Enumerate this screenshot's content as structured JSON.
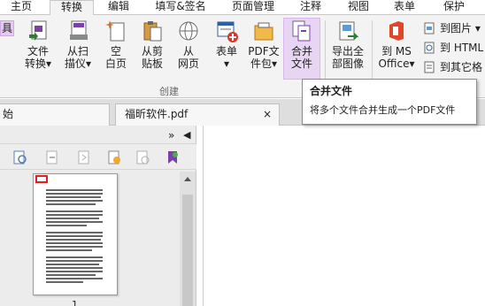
{
  "ribbon_tabs": [
    "主页",
    "转换",
    "编辑",
    "填写&签名",
    "页面管理",
    "注释",
    "视图",
    "表单",
    "保护"
  ],
  "active_tab": "转换",
  "left_stub": "具",
  "ribbon_buttons": {
    "file_convert": {
      "line1": "文件",
      "line2": "转换▾",
      "icon": "file-convert-icon"
    },
    "from_scanner": {
      "line1": "从扫",
      "line2": "描仪▾",
      "icon": "scanner-icon"
    },
    "blank_page": {
      "line1": "空",
      "line2": "白页",
      "icon": "blank-page-icon"
    },
    "from_clipboard": {
      "line1": "从剪",
      "line2": "贴板",
      "icon": "clipboard-icon"
    },
    "from_webpage": {
      "line1": "从",
      "line2": "网页",
      "icon": "globe-icon"
    },
    "form": {
      "line1": "表单",
      "line2": "▾",
      "icon": "form-icon"
    },
    "pdf_portfolio": {
      "line1": "PDF文",
      "line2": "件包▾",
      "icon": "portfolio-icon"
    },
    "merge_files": {
      "line1": "合并",
      "line2": "文件",
      "icon": "merge-icon"
    },
    "export_images": {
      "line1": "导出全",
      "line2": "部图像",
      "icon": "export-images-icon"
    },
    "to_ms_office": {
      "line1": "到 MS",
      "line2": "Office▾",
      "icon": "office-icon"
    }
  },
  "small_buttons": [
    "到图片 ▾",
    "到 HTML",
    "到其它格"
  ],
  "group_label": "创建",
  "doc_tabs": {
    "start": "始",
    "file": "福昕软件.pdf",
    "close": "×"
  },
  "panel": {
    "collapse": "»",
    "arrow": "◀",
    "page_number": "1"
  },
  "tooltip": {
    "title": "合并文件",
    "description": "将多个文件合并生成一个PDF文件"
  },
  "colors": {
    "ribbon_bg": "#f3f3f3",
    "highlight": "#e8d4f3",
    "accent_red": "#e02020",
    "accent_purple": "#7b3fa8"
  }
}
